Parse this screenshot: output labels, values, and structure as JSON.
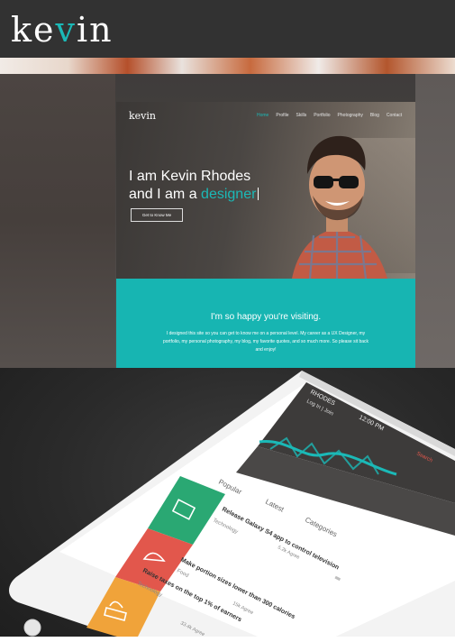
{
  "header": {
    "logo_pre": "ke",
    "logo_v": "v",
    "logo_post": "in"
  },
  "site_preview": {
    "logo": "kevin",
    "nav": [
      "Home",
      "Profile",
      "Skills",
      "Portfolio",
      "Photography",
      "Blog",
      "Contact"
    ],
    "headline_line1": "I am Kevin Rhodes",
    "headline_line2_pre": "and I am a ",
    "headline_line2_accent": "designer",
    "cta_label": "Get to Know Me",
    "band_heading": "I'm so happy you're visiting.",
    "band_text": "I designed this site so you can get to know me on a personal level. My career as a UX Designer, my portfolio, my personal photography, my blog, my favorite quotes, and so much more. So please sit back and enjoy!"
  },
  "phone": {
    "carrier": "RHODES",
    "time": "12:00 PM",
    "login": "Log In | Join",
    "search": "Search",
    "tabs": [
      "Popular",
      "Latest",
      "Categories"
    ],
    "articles": [
      {
        "title": "Release Galaxy S4 app to control television",
        "category": "Technology",
        "time": "5.2k Agree"
      },
      {
        "title": "Make portion sizes lower than 300 calories",
        "category": "Food",
        "time": "15k Agree"
      },
      {
        "title": "Raise taxes on the top 1% of earners",
        "category": "Technology",
        "time": "33.4k Agree"
      }
    ]
  },
  "colors": {
    "accent": "#1bb9b7",
    "header_bg": "#323232",
    "card_green": "#2aa873",
    "card_red": "#e2574c",
    "card_orange": "#f0a33a"
  }
}
